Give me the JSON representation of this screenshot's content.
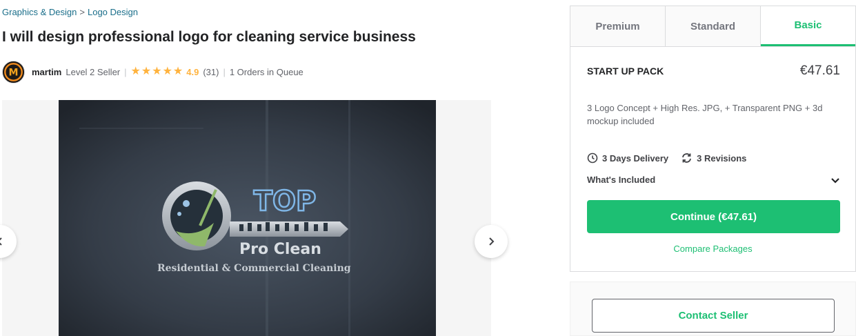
{
  "breadcrumb": {
    "category": "Graphics & Design",
    "separator": ">",
    "subcategory": "Logo Design"
  },
  "gig": {
    "title": "I will design professional logo for cleaning service business"
  },
  "seller": {
    "name": "martim",
    "level": "Level 2 Seller",
    "rating": "4.9",
    "stars": 5,
    "reviews": "(31)",
    "queue": "1 Orders in Queue",
    "divider": "|",
    "avatar_letter": "M"
  },
  "gallery": {
    "logo": {
      "brand_top": "TOP",
      "brand_name": "Pro Clean",
      "tagline": "Residential & Commercial Cleaning"
    },
    "prev_icon": "chevron-left-icon",
    "next_icon": "chevron-right-icon"
  },
  "packages": {
    "tabs": [
      {
        "label": "Premium",
        "active": false
      },
      {
        "label": "Standard",
        "active": false
      },
      {
        "label": "Basic",
        "active": true
      }
    ],
    "selected": {
      "name": "START UP PACK",
      "price": "€47.61",
      "description": "3 Logo Concept + High Res. JPG, + Transparent PNG + 3d mockup included",
      "delivery": "3 Days Delivery",
      "revisions": "3 Revisions",
      "whats_included": "What's Included"
    },
    "continue_label": "Continue (€47.61)",
    "compare_label": "Compare Packages"
  },
  "contact": {
    "label": "Contact Seller"
  },
  "colors": {
    "accent": "#1dbf73",
    "star": "#ffb33e",
    "link": "#1a6e8a"
  }
}
